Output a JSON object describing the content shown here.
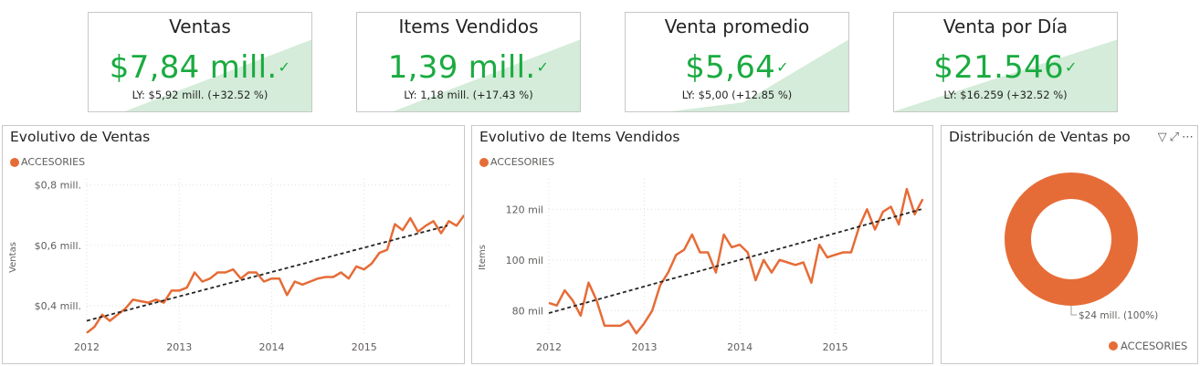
{
  "kpis": [
    {
      "title": "Ventas",
      "value": "$7,84 mill.",
      "goal": "LY: $5,92 mill. (+32.52 %)"
    },
    {
      "title": "Items Vendidos",
      "value": "1,39 mill.",
      "goal": "LY: 1,18 mill. (+17.43 %)"
    },
    {
      "title": "Venta promedio",
      "value": "$5,64",
      "goal": "LY: $5,00 (+12.85 %)"
    },
    {
      "title": "Venta por Día",
      "value": "$21.546",
      "goal": "LY: $16.259 (+32.52 %)"
    }
  ],
  "colors": {
    "series": "#e66c37",
    "kpi_good": "#1aab40",
    "spark_fill": "#d4ecd9",
    "trend": "#252423"
  },
  "chart_data": [
    {
      "type": "line",
      "title": "Evolutivo de Ventas",
      "ylabel": "Ventas",
      "xlabel": "",
      "series": [
        {
          "name": "ACCESORIES",
          "x_start": 2012.0,
          "x_step": 0.0833,
          "values": [
            0.31,
            0.33,
            0.37,
            0.35,
            0.37,
            0.39,
            0.42,
            0.415,
            0.41,
            0.42,
            0.41,
            0.45,
            0.45,
            0.46,
            0.51,
            0.48,
            0.49,
            0.51,
            0.51,
            0.52,
            0.49,
            0.51,
            0.51,
            0.48,
            0.49,
            0.49,
            0.435,
            0.48,
            0.47,
            0.48,
            0.49,
            0.495,
            0.495,
            0.51,
            0.49,
            0.53,
            0.52,
            0.54,
            0.575,
            0.585,
            0.67,
            0.65,
            0.69,
            0.645,
            0.665,
            0.68,
            0.64,
            0.68,
            0.665,
            0.7
          ]
        }
      ],
      "trend": {
        "x": [
          2012.0,
          2015.9
        ],
        "y": [
          0.35,
          0.665
        ]
      },
      "xlim": [
        2012.0,
        2015.95
      ],
      "ylim": [
        0.3,
        0.82
      ],
      "xticks": [
        {
          "v": 2012,
          "label": "2012"
        },
        {
          "v": 2013,
          "label": "2013"
        },
        {
          "v": 2014,
          "label": "2014"
        },
        {
          "v": 2015,
          "label": "2015"
        }
      ],
      "yticks": [
        {
          "v": 0.4,
          "label": "$0,4 mill."
        },
        {
          "v": 0.6,
          "label": "$0,6 mill."
        },
        {
          "v": 0.8,
          "label": "$0,8 mill."
        }
      ],
      "grid": true,
      "legend": "top-left"
    },
    {
      "type": "line",
      "title": "Evolutivo de Items Vendidos",
      "ylabel": "Items",
      "xlabel": "",
      "series": [
        {
          "name": "ACCESORIES",
          "x_start": 2012.0,
          "x_step": 0.0833,
          "values": [
            83,
            82,
            88,
            84,
            78,
            91,
            84,
            74,
            74,
            74,
            76,
            71,
            75,
            80,
            90,
            95,
            102,
            104,
            110,
            103,
            103,
            95,
            110,
            105,
            106,
            103,
            92,
            100,
            95,
            100,
            99,
            98,
            99,
            91,
            106,
            101,
            102,
            103,
            103,
            113,
            120,
            112,
            119,
            121,
            114,
            128,
            118,
            124
          ]
        }
      ],
      "trend": {
        "x": [
          2012.0,
          2015.9
        ],
        "y": [
          79,
          120
        ]
      },
      "xlim": [
        2012.0,
        2015.95
      ],
      "ylim": [
        70,
        132
      ],
      "xticks": [
        {
          "v": 2012,
          "label": "2012"
        },
        {
          "v": 2013,
          "label": "2013"
        },
        {
          "v": 2014,
          "label": "2014"
        },
        {
          "v": 2015,
          "label": "2015"
        }
      ],
      "yticks": [
        {
          "v": 80,
          "label": "80 mil"
        },
        {
          "v": 100,
          "label": "100 mil"
        },
        {
          "v": 120,
          "label": "120 mil"
        }
      ],
      "grid": true,
      "legend": "top-left"
    },
    {
      "type": "pie",
      "variant": "donut",
      "title": "Distribución de Ventas po",
      "slices": [
        {
          "name": "ACCESORIES",
          "value": 24,
          "percent": 100,
          "label": "$24 mill. (100%)"
        }
      ],
      "legend": "bottom-right"
    }
  ]
}
